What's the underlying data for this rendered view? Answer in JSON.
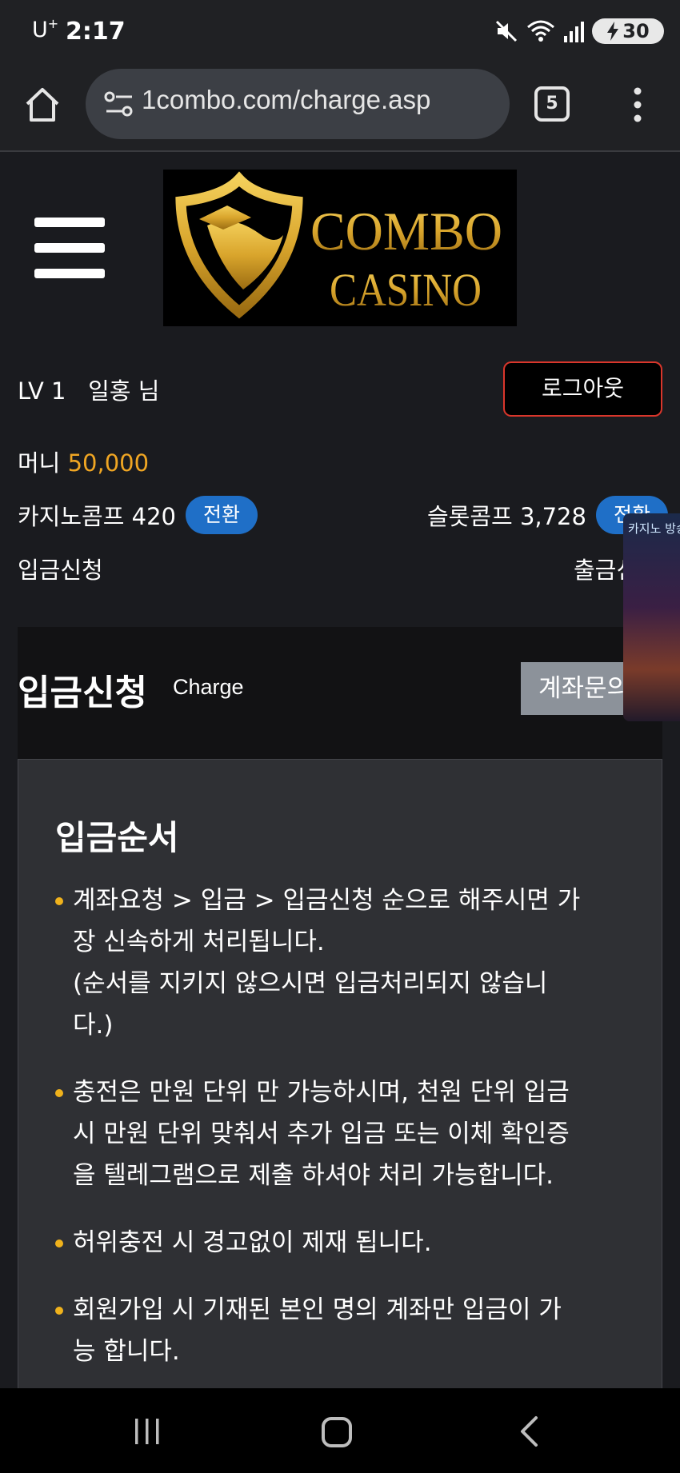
{
  "status_bar": {
    "carrier": "U",
    "carrier_sup": "+",
    "time": "2:17",
    "battery": "30",
    "icons": [
      "mute-icon",
      "wifi-icon",
      "signal-icon",
      "charging-icon"
    ]
  },
  "browser": {
    "url": "1combo.com/charge.asp",
    "tab_count": "5"
  },
  "header": {
    "logo_line1": "COMBO",
    "logo_line2": "CASINO"
  },
  "user": {
    "level": "LV 1",
    "name": "일홍 님",
    "logout_label": "로그아웃",
    "money_label": "머니",
    "money_value": "50,000",
    "casino_comp_label": "카지노콤프 420",
    "slot_comp_label": "슬롯콤프 3,728",
    "convert_label": "전환",
    "deposit_link": "입금신청",
    "withdraw_link": "출금신"
  },
  "float_banner": {
    "text": "카지노 방송"
  },
  "charge": {
    "title": "입금신청",
    "subtitle": "Charge",
    "account_button": "계좌문의"
  },
  "order": {
    "title": "입금순서",
    "items": [
      {
        "line1": "계좌요청 > 입금 > 입금신청 순으로 해주시면 가",
        "line2": "장 신속하게 처리됩니다.",
        "line3": "(순서를 지키지 않으시면 입금처리되지 않습니",
        "line4": "다.)"
      },
      {
        "line1": "충전은 만원 단위 만 가능하시며, 천원 단위 입금",
        "line2": "시 만원 단위 맞춰서 추가 입금 또는 이체 확인증",
        "line3": "을 텔레그램으로 제출 하셔야 처리 가능합니다."
      },
      {
        "line1": "허위충전 시 경고없이 제재 됩니다."
      },
      {
        "line1": "회원가입 시 기재된 본인 명의 계좌만 입금이 가",
        "line2": "능 합니다."
      }
    ]
  },
  "colors": {
    "accent_gold": "#f0a623",
    "convert_blue": "#1f6fc7",
    "logout_border": "#d9362b",
    "logo_gold": "#d9a52c"
  }
}
